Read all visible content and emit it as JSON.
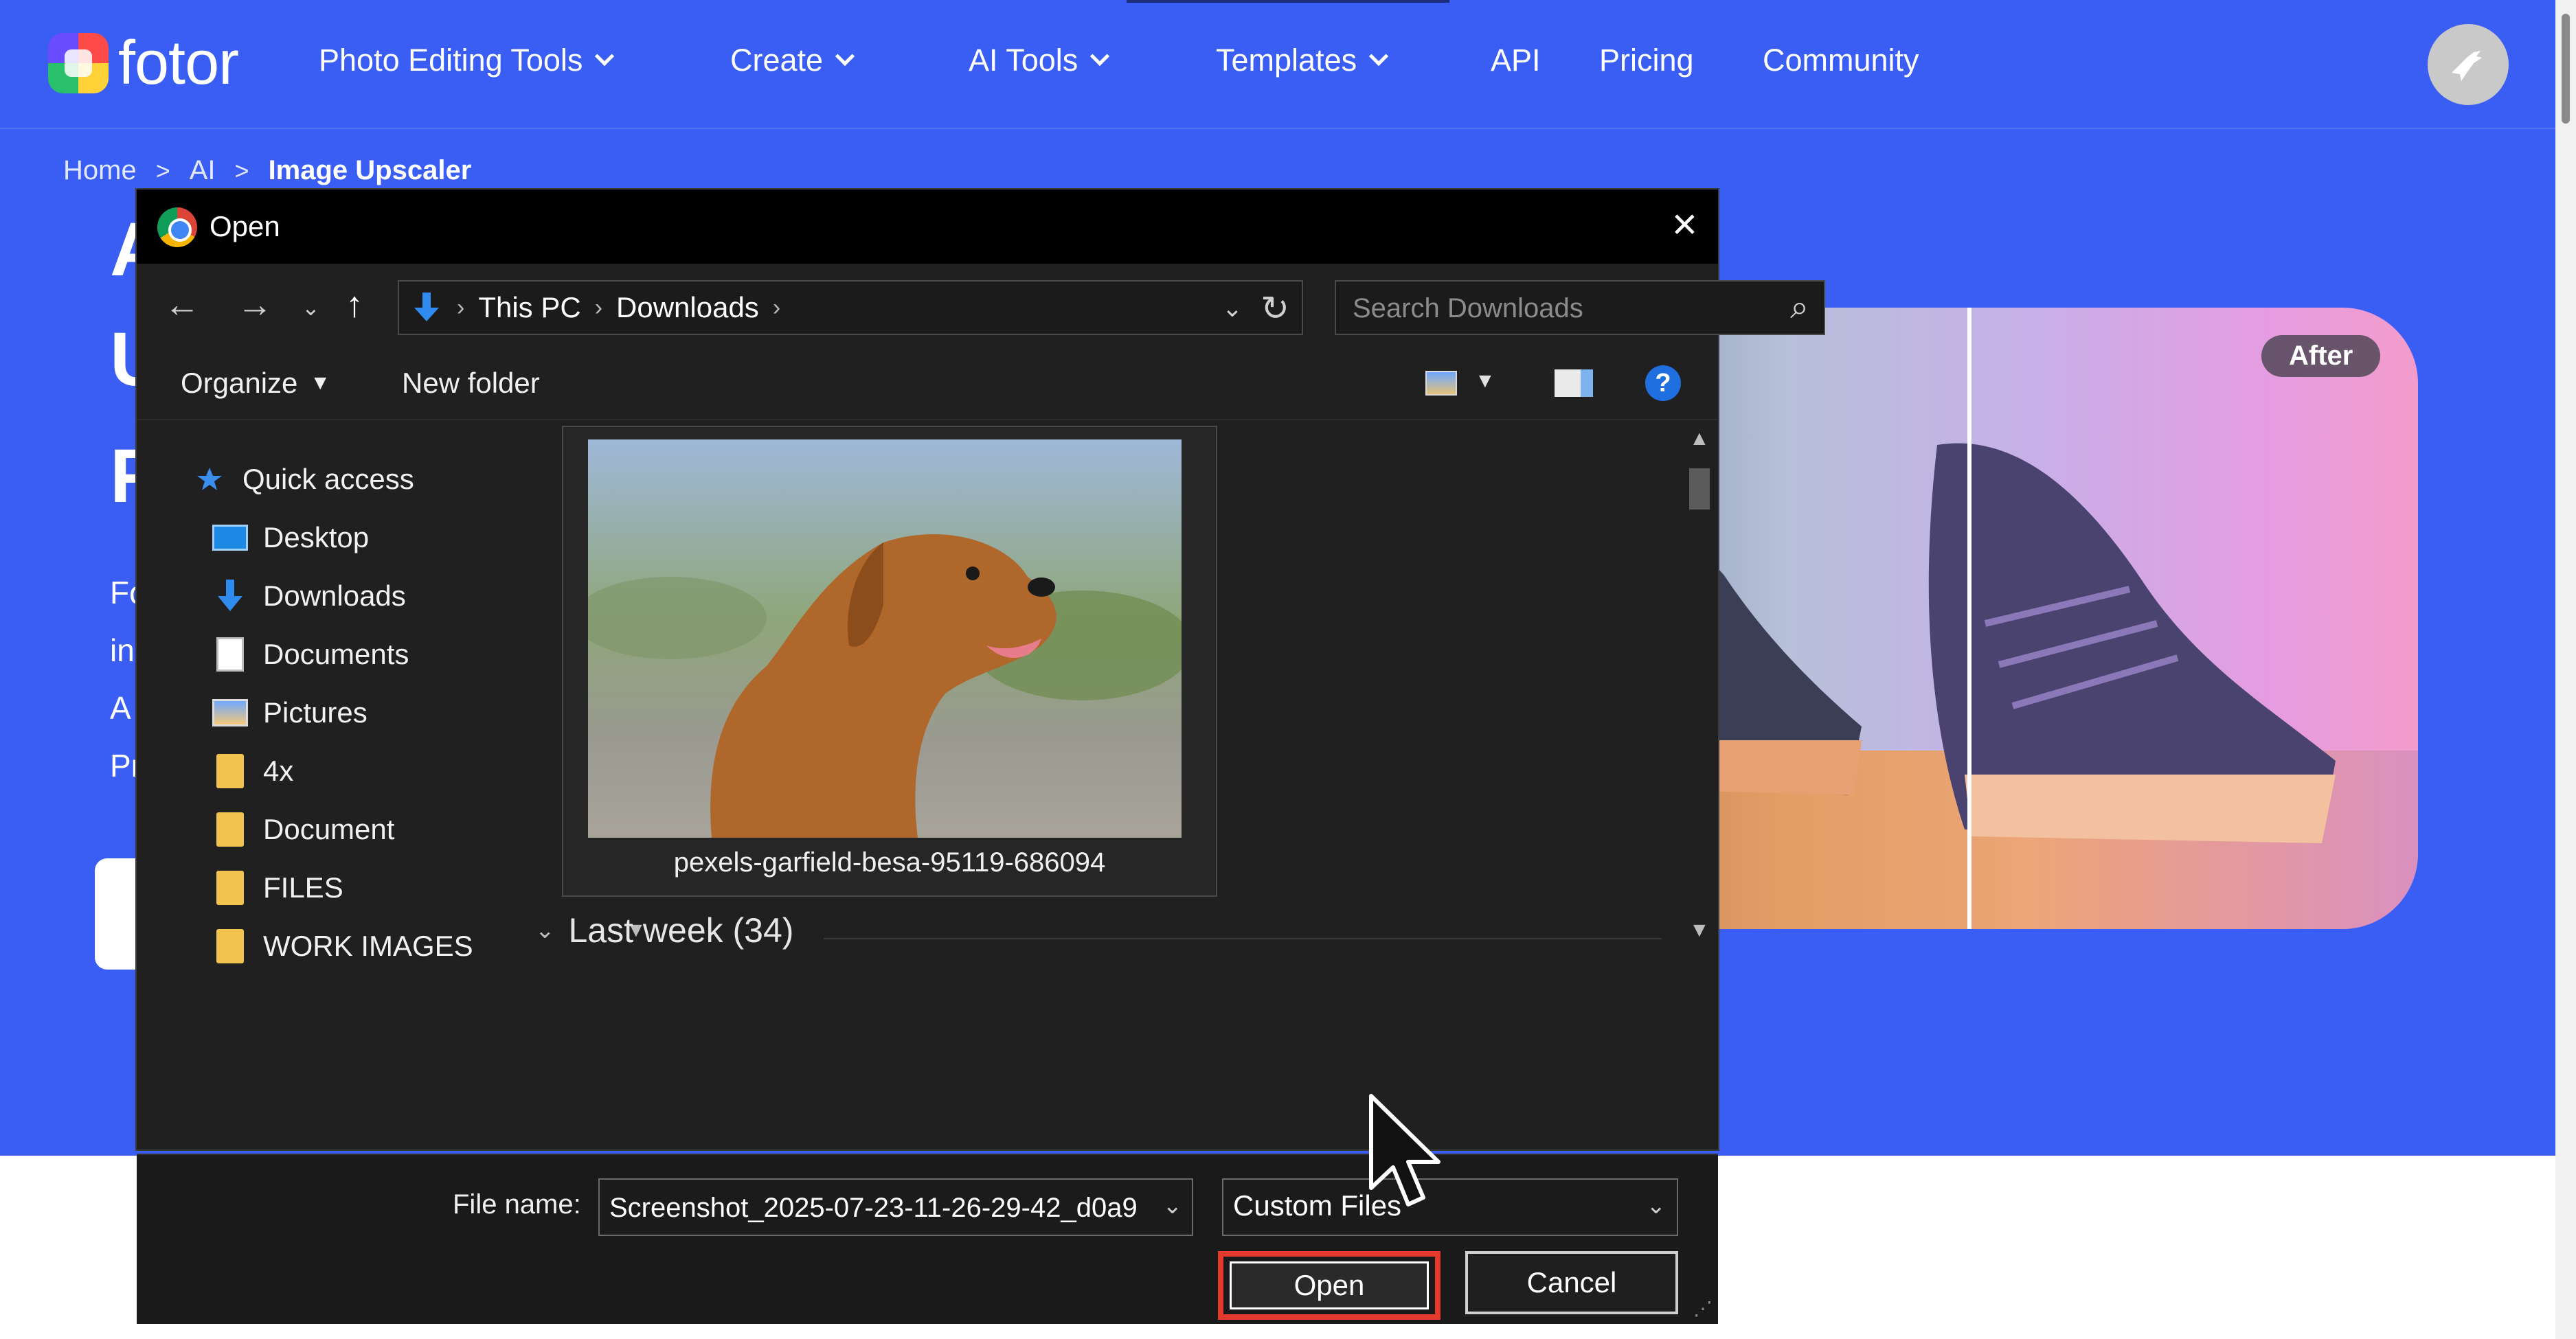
{
  "colors": {
    "hero_bg": "#3a5ef3",
    "dialog_bg": "#202020",
    "highlight": "#e53a2b"
  },
  "header": {
    "logo_text": "fotor",
    "nav": [
      {
        "label": "Photo Editing Tools",
        "has_dropdown": true
      },
      {
        "label": "Create",
        "has_dropdown": true
      },
      {
        "label": "AI Tools",
        "has_dropdown": true
      },
      {
        "label": "Templates",
        "has_dropdown": true
      },
      {
        "label": "API",
        "has_dropdown": false
      },
      {
        "label": "Pricing",
        "has_dropdown": false
      },
      {
        "label": "Community",
        "has_dropdown": false
      }
    ]
  },
  "breadcrumb": {
    "home": "Home",
    "sep1": ">",
    "ai": "AI",
    "sep2": ">",
    "current": "Image Upscaler"
  },
  "hero": {
    "partial_lines": [
      "A",
      "U",
      "F"
    ],
    "partial_desc": [
      "Fo",
      "in",
      "A",
      "Pr"
    ],
    "compare_badge": "After"
  },
  "dialog": {
    "title": "Open",
    "close_icon": "close-icon",
    "address": {
      "crumbs": [
        "This PC",
        "Downloads"
      ]
    },
    "search_placeholder": "Search Downloads",
    "toolbar": {
      "organize": "Organize",
      "new_folder": "New folder",
      "help": "?"
    },
    "sidebar": [
      {
        "label": "Quick access",
        "icon": "star-icon",
        "pinned": false
      },
      {
        "label": "Desktop",
        "icon": "desktop-icon",
        "pinned": true
      },
      {
        "label": "Downloads",
        "icon": "download-arrow-icon",
        "pinned": true
      },
      {
        "label": "Documents",
        "icon": "document-icon",
        "pinned": true
      },
      {
        "label": "Pictures",
        "icon": "pictures-icon",
        "pinned": true
      },
      {
        "label": "4x",
        "icon": "folder-icon",
        "pinned": false
      },
      {
        "label": "Document",
        "icon": "folder-icon",
        "pinned": false
      },
      {
        "label": "FILES",
        "icon": "folder-icon",
        "pinned": false
      },
      {
        "label": "WORK IMAGES",
        "icon": "folder-icon",
        "pinned": false
      }
    ],
    "file": {
      "name": "pexels-garfield-besa-95119-686094"
    },
    "group": {
      "label": "Last week (34)"
    },
    "file_name_label": "File name:",
    "file_name_value": "Screenshot_2025-07-23-11-26-29-42_d0a9",
    "file_type": "Custom Files",
    "open_label": "Open",
    "cancel_label": "Cancel"
  }
}
